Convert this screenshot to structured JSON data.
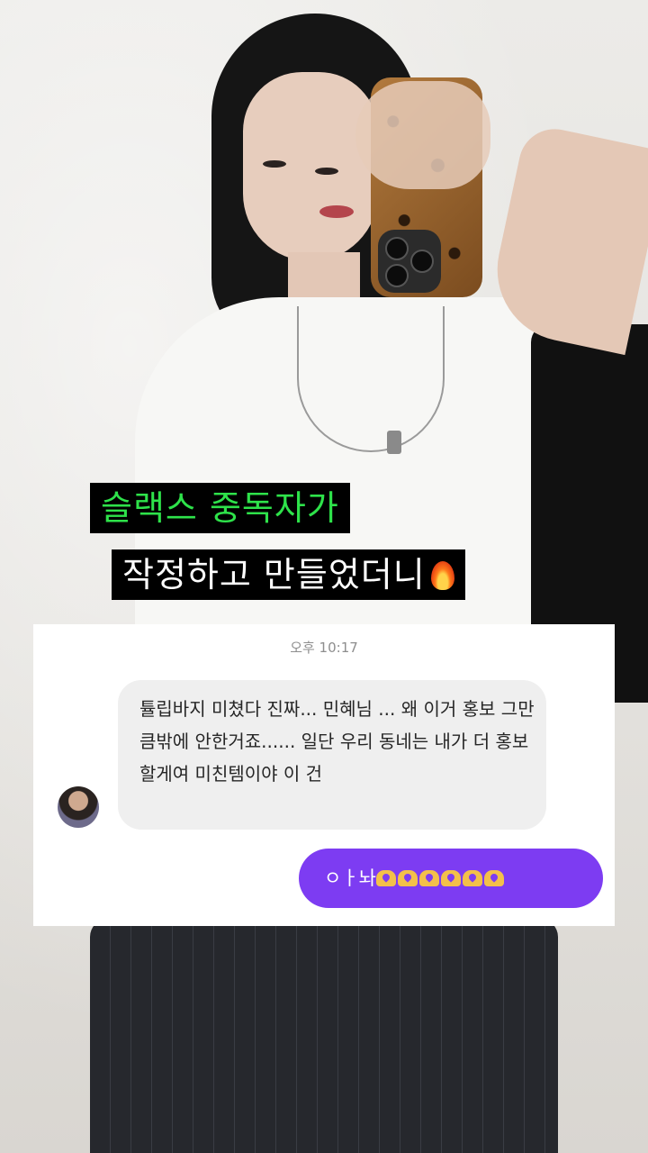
{
  "overlay": {
    "caption_line1": "슬랙스 중독자가",
    "caption_line2": "작정하고 만들었더니",
    "caption_line1_color": "#2ee24a",
    "caption_line2_color": "#ffffff",
    "caption_icon": "fire-icon"
  },
  "chat": {
    "timestamp": "오후 10:17",
    "incoming": {
      "avatar_icon": "avatar",
      "text": "튤립바지 미쳤다 진짜... 민혜님 ... 왜 이거 홍보 그만큼밖에 안한거죠...... 일단 우리 동네는 내가 더 홍보할게여 미친템이야 이 건"
    },
    "outgoing": {
      "text": "ㅇㅏ놔",
      "emoji_icon": "heart-hands-icon",
      "emoji_count": 6,
      "bubble_color": "#7d3cf2"
    }
  }
}
